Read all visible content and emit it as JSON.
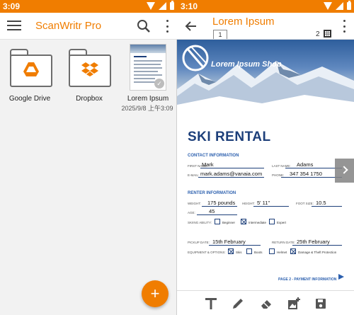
{
  "status": {
    "left_time": "3:09",
    "right_time": "3:10"
  },
  "left_pane": {
    "app_title": "ScanWritr Pro",
    "tiles": [
      {
        "label": "Google Drive",
        "icon": "google-drive-icon"
      },
      {
        "label": "Dropbox",
        "icon": "dropbox-icon"
      },
      {
        "label": "Lorem Ipsum",
        "sub": "2025/9/8 上午3:09",
        "icon": "document-thumbnail"
      }
    ],
    "fab": "+"
  },
  "right_pane": {
    "doc_title": "Lorem Ipsum",
    "current_page": "1",
    "page_count": "2",
    "document": {
      "shop_name": "Lorem Ipsum Shop",
      "heading": "SKI RENTAL",
      "contact_section": "CONTACT INFORMATION",
      "first_name_label": "FIRST NAME:",
      "first_name": "Mark",
      "last_name_label": "LAST NAME:",
      "last_name": "Adams",
      "email_label": "E-MAIL:",
      "email": "mark.adams@vanaia.com",
      "phone_label": "PHONE:",
      "phone": "347 354 1750",
      "renter_section": "RENTER INFORMATION",
      "weight_label": "WEIGHT:",
      "weight": "175 pounds",
      "height_label": "HEIGHT:",
      "height": "5' 11\"",
      "foot_label": "FOOT SIZE:",
      "foot": "10.5",
      "age_label": "AGE:",
      "age": "45",
      "skiing_label": "SKIING ABILITY:",
      "skiing_options": [
        "Beginner",
        "Intermediate",
        "Expert"
      ],
      "pickup_label": "PICKUP DATE:",
      "pickup": "15th February",
      "return_label": "RETURN DATE:",
      "return": "25th February",
      "equipment_label": "EQUIPMENT & OPTIONS:",
      "equipment_options": [
        "Skis",
        "Boots",
        "Helmet",
        "Damage & Theft Protection"
      ],
      "next_info": "PAGE 2 - PAYMENT INFORMATION"
    }
  },
  "colors": {
    "accent": "#f07d00",
    "doc_blue": "#1d3f7a"
  }
}
